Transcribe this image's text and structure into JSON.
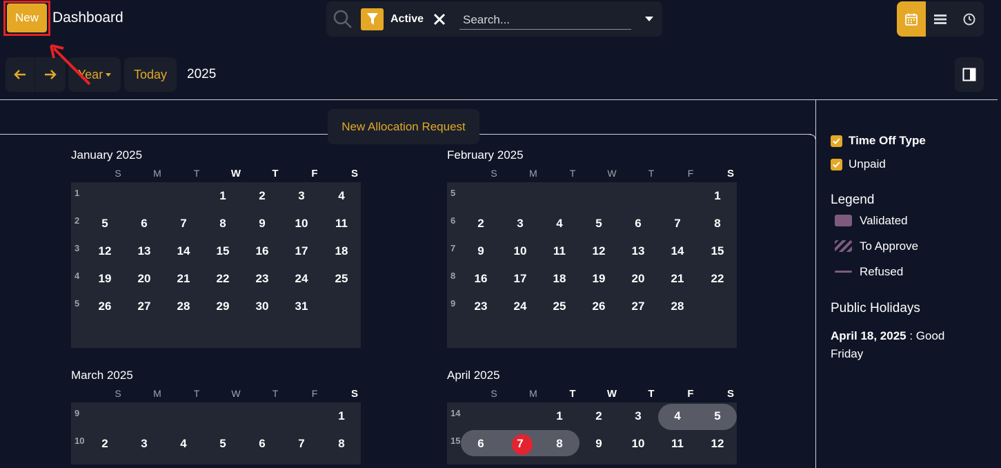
{
  "topbar": {
    "new_label": "New",
    "title": "Dashboard",
    "filter_label": "Active",
    "search_placeholder": "Search...",
    "views": [
      "calendar-icon",
      "list-icon",
      "clock-icon"
    ],
    "active_view": "calendar-icon"
  },
  "toolbar": {
    "scale_label": "Year",
    "today_label": "Today",
    "period": "2025",
    "allocation_label": "New Allocation Request"
  },
  "colors": {
    "accent": "#e4a826",
    "background": "#0f1526",
    "panel": "#222733",
    "highlight_box": "#e52124",
    "today": "#e52330",
    "validated": "#7e5b7e"
  },
  "months": [
    {
      "title": "January 2025",
      "dow": [
        "S",
        "M",
        "T",
        "W",
        "T",
        "F",
        "S"
      ],
      "dow_bold": [
        false,
        false,
        false,
        true,
        true,
        true,
        true
      ],
      "weeks": [
        {
          "num": "1",
          "days": [
            "",
            "",
            "",
            "1",
            "2",
            "3",
            "4"
          ]
        },
        {
          "num": "2",
          "days": [
            "5",
            "6",
            "7",
            "8",
            "9",
            "10",
            "11"
          ]
        },
        {
          "num": "3",
          "days": [
            "12",
            "13",
            "14",
            "15",
            "16",
            "17",
            "18"
          ]
        },
        {
          "num": "4",
          "days": [
            "19",
            "20",
            "21",
            "22",
            "23",
            "24",
            "25"
          ]
        },
        {
          "num": "5",
          "days": [
            "26",
            "27",
            "28",
            "29",
            "30",
            "31",
            ""
          ]
        }
      ]
    },
    {
      "title": "February 2025",
      "dow": [
        "S",
        "M",
        "T",
        "W",
        "T",
        "F",
        "S"
      ],
      "dow_bold": [
        false,
        false,
        false,
        false,
        false,
        false,
        true
      ],
      "weeks": [
        {
          "num": "5",
          "days": [
            "",
            "",
            "",
            "",
            "",
            "",
            "1"
          ]
        },
        {
          "num": "6",
          "days": [
            "2",
            "3",
            "4",
            "5",
            "6",
            "7",
            "8"
          ]
        },
        {
          "num": "7",
          "days": [
            "9",
            "10",
            "11",
            "12",
            "13",
            "14",
            "15"
          ]
        },
        {
          "num": "8",
          "days": [
            "16",
            "17",
            "18",
            "19",
            "20",
            "21",
            "22"
          ]
        },
        {
          "num": "9",
          "days": [
            "23",
            "24",
            "25",
            "26",
            "27",
            "28",
            ""
          ]
        }
      ]
    },
    {
      "title": "March 2025",
      "dow": [
        "S",
        "M",
        "T",
        "W",
        "T",
        "F",
        "S"
      ],
      "dow_bold": [
        false,
        false,
        false,
        false,
        false,
        false,
        true
      ],
      "weeks": [
        {
          "num": "9",
          "days": [
            "",
            "",
            "",
            "",
            "",
            "",
            "1"
          ]
        },
        {
          "num": "10",
          "days": [
            "2",
            "3",
            "4",
            "5",
            "6",
            "7",
            "8"
          ]
        }
      ]
    },
    {
      "title": "April 2025",
      "dow": [
        "S",
        "M",
        "T",
        "W",
        "T",
        "F",
        "S"
      ],
      "dow_bold": [
        false,
        false,
        true,
        true,
        true,
        true,
        true
      ],
      "weeks": [
        {
          "num": "14",
          "days": [
            "",
            "",
            "1",
            "2",
            "3",
            "4",
            "5"
          ]
        },
        {
          "num": "15",
          "days": [
            "6",
            "7",
            "8",
            "9",
            "10",
            "11",
            "12"
          ]
        }
      ],
      "today": "7"
    }
  ],
  "side": {
    "filters": [
      {
        "label": "Time Off Type",
        "bold": true
      },
      {
        "label": "Unpaid",
        "bold": false
      }
    ],
    "legend_title": "Legend",
    "legend": [
      {
        "label": "Validated",
        "kind": "validated"
      },
      {
        "label": "To Approve",
        "kind": "approve"
      },
      {
        "label": "Refused",
        "kind": "refused"
      }
    ],
    "holidays_title": "Public Holidays",
    "holiday_date": "April 18, 2025",
    "holiday_sep": " : Good",
    "holiday_rest": "Friday"
  }
}
